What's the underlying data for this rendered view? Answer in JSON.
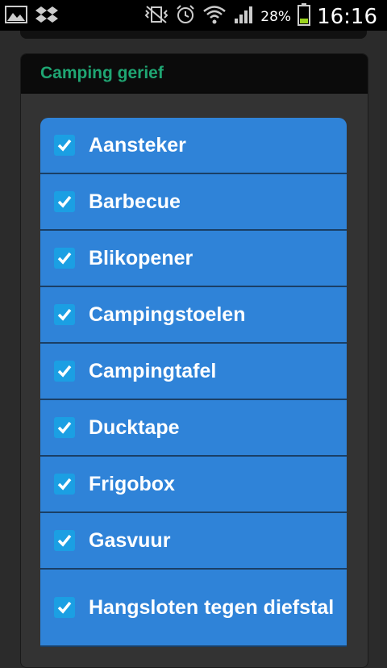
{
  "status_bar": {
    "battery_percent": "28%",
    "time": "16:16"
  },
  "section": {
    "title": "Camping gerief"
  },
  "items": [
    {
      "label": "Aansteker",
      "checked": true
    },
    {
      "label": "Barbecue",
      "checked": true
    },
    {
      "label": "Blikopener",
      "checked": true
    },
    {
      "label": "Campingstoelen",
      "checked": true
    },
    {
      "label": "Campingtafel",
      "checked": true
    },
    {
      "label": "Ducktape",
      "checked": true
    },
    {
      "label": "Frigobox",
      "checked": true
    },
    {
      "label": "Gasvuur",
      "checked": true
    },
    {
      "label": "Hangsloten tegen diefstal",
      "checked": true
    }
  ],
  "colors": {
    "accent_green": "#1fa673",
    "item_blue": "#2f83d8",
    "checkbox_blue": "#1b9fe3"
  }
}
